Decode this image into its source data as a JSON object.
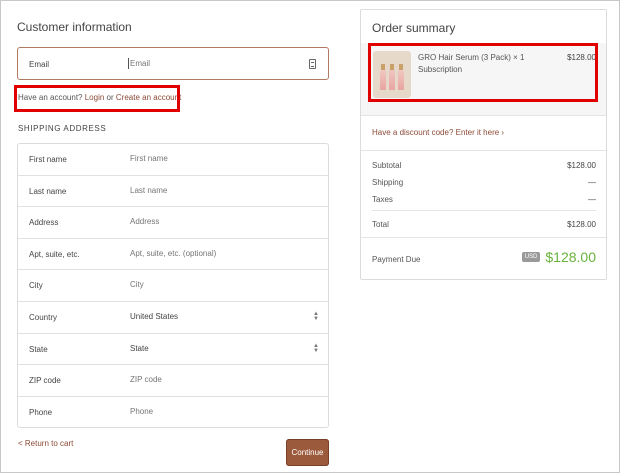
{
  "customer": {
    "title": "Customer information",
    "email_label": "Email",
    "email_placeholder": "Email",
    "account_prefix": "Have an account?",
    "login_label": "Login",
    "or_text": "or",
    "create_account_label": "Create an account"
  },
  "shipping": {
    "title": "SHIPPING ADDRESS",
    "fields": [
      {
        "label": "First name",
        "placeholder": "First name"
      },
      {
        "label": "Last name",
        "placeholder": "Last name"
      },
      {
        "label": "Address",
        "placeholder": "Address"
      },
      {
        "label": "Apt, suite, etc.",
        "placeholder": "Apt, suite, etc. (optional)"
      },
      {
        "label": "City",
        "placeholder": "City"
      },
      {
        "label": "Country",
        "value": "United States"
      },
      {
        "label": "State",
        "value": "State"
      },
      {
        "label": "ZIP code",
        "placeholder": "ZIP code"
      },
      {
        "label": "Phone",
        "placeholder": "Phone"
      }
    ]
  },
  "actions": {
    "return_label": "< Return to cart",
    "continue_label": "Continue"
  },
  "summary": {
    "title": "Order summary",
    "product": {
      "name": "GRO Hair Serum (3 Pack) × 1",
      "subtitle": "Subscription",
      "price": "$128.00"
    },
    "discount_label": "Have a discount code? Enter it here",
    "rows": [
      {
        "label": "Subtotal",
        "value": "$128.00"
      },
      {
        "label": "Shipping",
        "value": "—"
      },
      {
        "label": "Taxes",
        "value": "—"
      },
      {
        "label": "Total",
        "value": "$128.00"
      }
    ],
    "payment_due_label": "Payment Due",
    "currency": "USD",
    "payment_due_amount": "$128.00"
  },
  "colors": {
    "accent": "#8b4a35",
    "button": "#9c5a3c",
    "due_green": "#69b23c",
    "highlight": "#e00000"
  }
}
